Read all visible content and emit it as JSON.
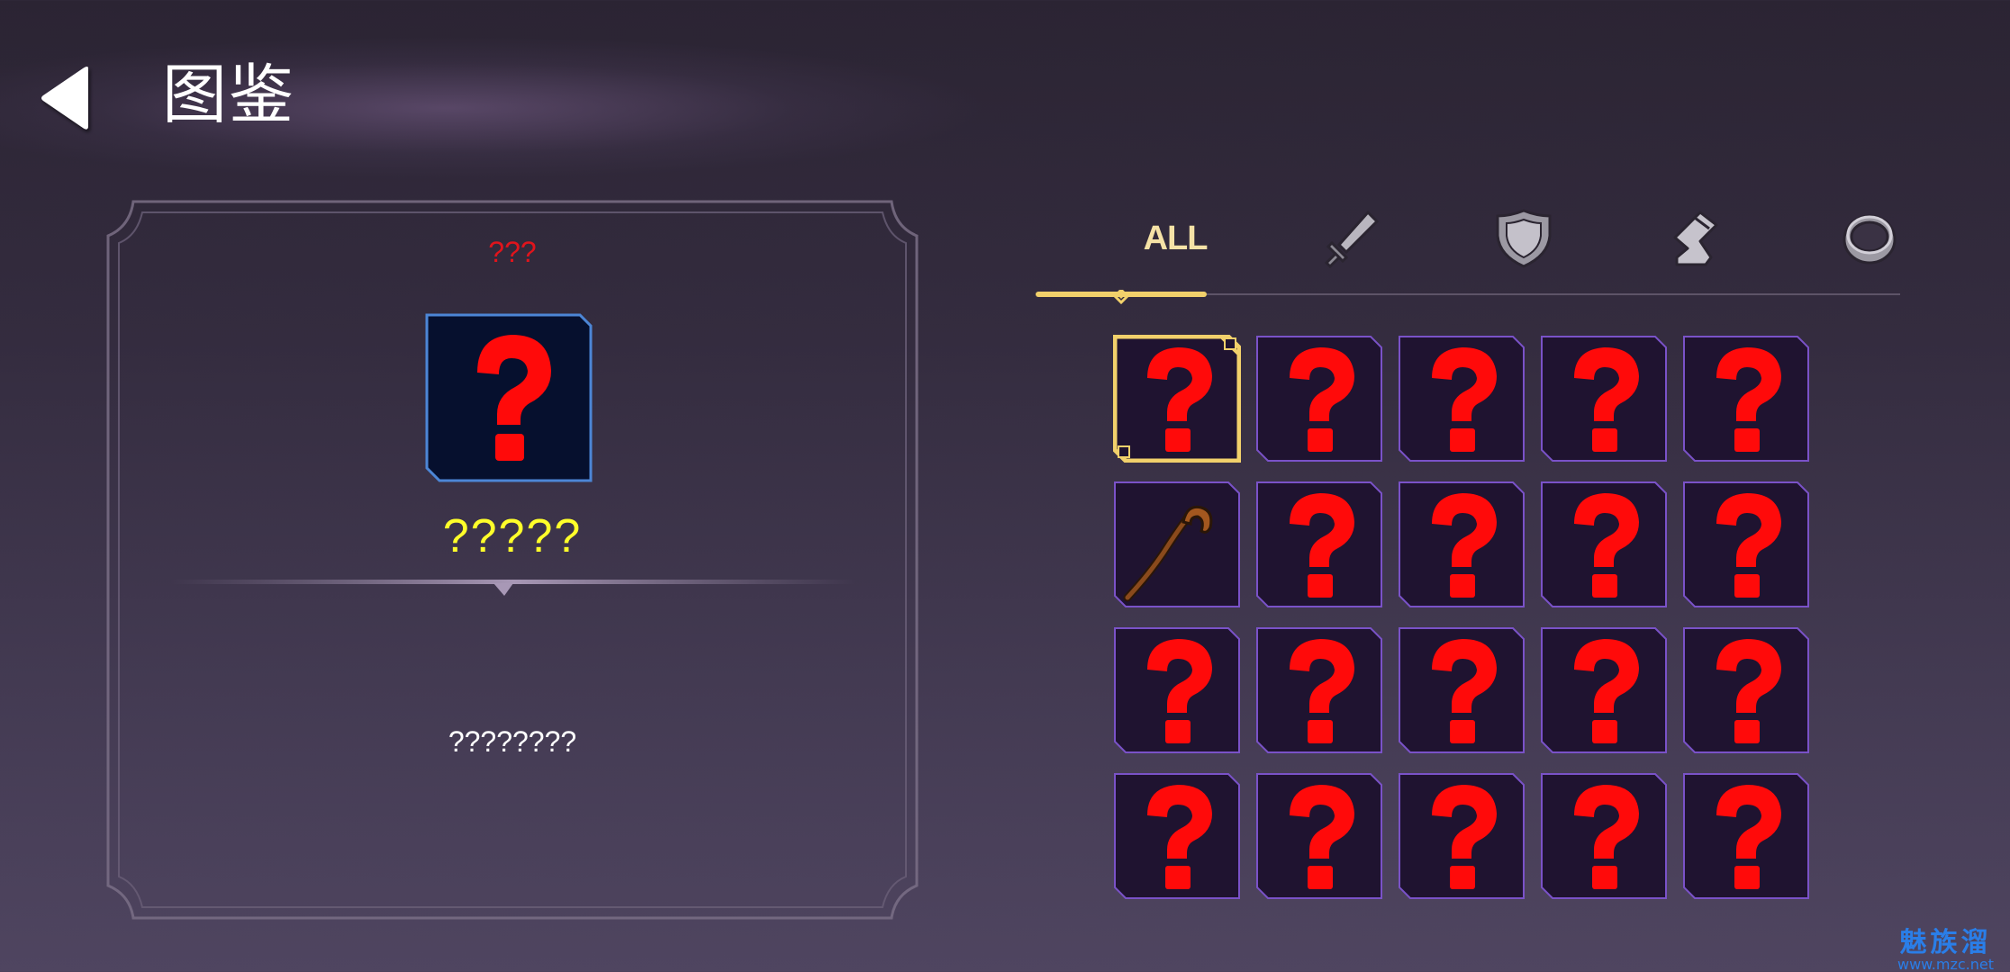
{
  "header": {
    "title": "图鉴"
  },
  "detail": {
    "rarity": "???",
    "name": "?????",
    "description": "????????",
    "icon": "question-mark-icon"
  },
  "tabs": [
    {
      "key": "all",
      "label": "ALL",
      "icon": "all-label",
      "selected": true
    },
    {
      "key": "weapon",
      "label": "",
      "icon": "sword-icon",
      "selected": false
    },
    {
      "key": "armor",
      "label": "",
      "icon": "shield-icon",
      "selected": false
    },
    {
      "key": "boots",
      "label": "",
      "icon": "boot-icon",
      "selected": false
    },
    {
      "key": "ring",
      "label": "",
      "icon": "ring-icon",
      "selected": false
    }
  ],
  "grid": {
    "columns": 5,
    "slots": [
      {
        "item": "unknown",
        "selected": true
      },
      {
        "item": "unknown"
      },
      {
        "item": "unknown"
      },
      {
        "item": "unknown"
      },
      {
        "item": "unknown"
      },
      {
        "item": "wooden-staff"
      },
      {
        "item": "unknown"
      },
      {
        "item": "unknown"
      },
      {
        "item": "unknown"
      },
      {
        "item": "unknown"
      },
      {
        "item": "unknown"
      },
      {
        "item": "unknown"
      },
      {
        "item": "unknown"
      },
      {
        "item": "unknown"
      },
      {
        "item": "unknown"
      },
      {
        "item": "unknown"
      },
      {
        "item": "unknown"
      },
      {
        "item": "unknown"
      },
      {
        "item": "unknown"
      },
      {
        "item": "unknown"
      }
    ]
  },
  "colors": {
    "accent_gold": "#f2d16b",
    "slot_border": "#7a52c8",
    "slot_fill": "#1f1330",
    "question_red": "#ff0a0a",
    "rarity_red": "#e0141c",
    "name_yellow": "#ffff2a"
  },
  "watermark": {
    "text": "魅族溜",
    "url": "www.mzc.net"
  }
}
